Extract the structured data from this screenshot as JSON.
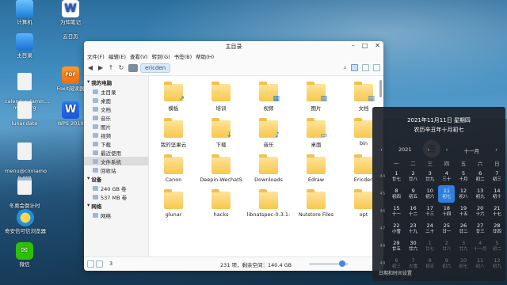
{
  "desktop": {
    "icons": [
      {
        "label": "计算机",
        "icon": "computer-icon"
      },
      {
        "label": "为知笔记",
        "icon": "wiz-icon"
      },
      {
        "label": "主目录",
        "icon": "home-folder-icon"
      },
      {
        "label": "云日历",
        "icon": "cloud-calendar-icon"
      },
      {
        "label": "calendar.damin...\nmom.org",
        "icon": "file-icon"
      },
      {
        "label": "Foxit阅读器",
        "icon": "pdf-icon"
      },
      {
        "label": "lunar.date",
        "icon": "file-icon"
      },
      {
        "label": "WPS 2019",
        "icon": "wps-icon"
      },
      {
        "label": "menu@cinnamo\nn.org",
        "icon": "file-icon"
      },
      {
        "label": "冬奥会倒计时\ndocx",
        "icon": "doc-icon"
      },
      {
        "label": "奇安信可信浏览器",
        "icon": "browser-icon"
      },
      {
        "label": "微信",
        "icon": "wechat-icon"
      }
    ]
  },
  "window": {
    "title": "主目录",
    "menu": [
      "文件(F)",
      "编辑(E)",
      "查看(V)",
      "转到(G)",
      "书签(B)",
      "帮助(H)"
    ],
    "breadcrumb": "ericden",
    "sidebar": {
      "groups": [
        {
          "title": "我的电脑",
          "items": [
            "主目录",
            "桌面",
            "文档",
            "音乐",
            "图片",
            "视频",
            "下载",
            "最近使用",
            "文件系统",
            "回收站"
          ]
        },
        {
          "title": "设备",
          "items": [
            "240 GB 卷",
            "537 MB 卷"
          ]
        },
        {
          "title": "网络",
          "items": [
            "网络"
          ]
        }
      ],
      "selected": "文件系统"
    },
    "files": [
      "模板",
      "培训",
      "视频",
      "图片",
      "文档",
      "我的坚果云",
      "下载",
      "音乐",
      "桌面",
      "bin",
      "Canon",
      "Deepin-WechatS",
      "Downloads",
      "Edraw",
      "Ericden",
      "glunar",
      "hacks",
      "libnatspec-0.3.1-",
      "Nutstore Files",
      "opt"
    ],
    "status": {
      "path_count": "3",
      "summary": "231 项，剩余空间：140.4 GB"
    },
    "zoom_level": 0.75
  },
  "calendar": {
    "date_line": "2021年11月11日 星期四",
    "lunar_line": "农历辛丑年十月初七",
    "year": "2021",
    "month": "十一月",
    "weekdays": [
      "一",
      "二",
      "三",
      "四",
      "五",
      "六",
      "日"
    ],
    "weeks": [
      {
        "wk": "44",
        "days": [
          [
            "1",
            "廿七"
          ],
          [
            "2",
            "廿八"
          ],
          [
            "3",
            "廿九"
          ],
          [
            "4",
            "三十"
          ],
          [
            "5",
            "十月"
          ],
          [
            "6",
            "初二"
          ],
          [
            "7",
            "初三"
          ]
        ]
      },
      {
        "wk": "45",
        "days": [
          [
            "8",
            "初四"
          ],
          [
            "9",
            "初五"
          ],
          [
            "10",
            "初六"
          ],
          [
            "11",
            "初七"
          ],
          [
            "12",
            "初八"
          ],
          [
            "13",
            "初九"
          ],
          [
            "14",
            "初十"
          ]
        ]
      },
      {
        "wk": "46",
        "days": [
          [
            "15",
            "十一"
          ],
          [
            "16",
            "十二"
          ],
          [
            "17",
            "十三"
          ],
          [
            "18",
            "十四"
          ],
          [
            "19",
            "十五"
          ],
          [
            "20",
            "十六"
          ],
          [
            "21",
            "十七"
          ]
        ]
      },
      {
        "wk": "47",
        "days": [
          [
            "22",
            "小雪"
          ],
          [
            "23",
            "十九"
          ],
          [
            "24",
            "二十"
          ],
          [
            "25",
            "廿一"
          ],
          [
            "26",
            "廿二"
          ],
          [
            "27",
            "廿三"
          ],
          [
            "28",
            "廿四"
          ]
        ]
      },
      {
        "wk": "48",
        "days": [
          [
            "29",
            "廿五"
          ],
          [
            "30",
            "廿六"
          ],
          [
            "1",
            "廿七"
          ],
          [
            "2",
            "廿八"
          ],
          [
            "3",
            "廿九"
          ],
          [
            "4",
            "十一月"
          ],
          [
            "5",
            "初二"
          ]
        ]
      },
      {
        "wk": "49",
        "days": [
          [
            "6",
            "初三"
          ],
          [
            "7",
            "大雪"
          ],
          [
            "8",
            "初五"
          ],
          [
            "9",
            "初六"
          ],
          [
            "10",
            "初七"
          ],
          [
            "11",
            "初八"
          ],
          [
            "12",
            "初九"
          ]
        ]
      }
    ],
    "footer": "日期和时间设置",
    "today": "11",
    "accent": "#2f7fe0"
  }
}
